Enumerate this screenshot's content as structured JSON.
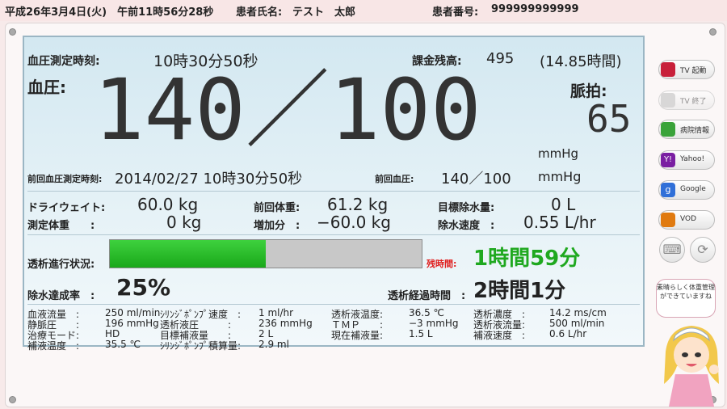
{
  "header": {
    "datetime": "平成26年3月4日(火)　午前11時56分28秒",
    "patient_name_label": "患者氏名:",
    "patient_name": "テスト　太郎",
    "patient_id_label": "患者番号:",
    "patient_id": "999999999999"
  },
  "bp": {
    "time_label": "血圧測定時刻:",
    "time": "10時30分50秒",
    "balance_label": "課金残高:",
    "balance": "495",
    "balance_hours": "(14.85時間)",
    "label": "血圧:",
    "value": "140／100",
    "unit": "mmHg",
    "pulse_label": "脈拍:",
    "pulse": "65"
  },
  "prev": {
    "time_label": "前回血圧測定時刻:",
    "datetime": "2014/02/27 10時30分50秒",
    "bp_label": "前回血圧:",
    "bp": "140／100",
    "unit": "mmHg"
  },
  "weights": {
    "dry_label": "ドライウェイト:",
    "dry": "60.0 kg",
    "prev_label": "前回体重:",
    "prev": "61.2 kg",
    "target_label": "目標除水量:",
    "target": "0 L",
    "measured_label": "測定体重　　:",
    "measured": "0 kg",
    "increase_label": "増加分　:",
    "increase": "−60.0 kg",
    "rate_label": "除水速度　:",
    "rate": "0.55 L/hr"
  },
  "progress": {
    "label": "透析進行状況:",
    "fraction": 0.5,
    "remaining_label": "残時間:",
    "remaining": "1時間59分"
  },
  "achievement": {
    "label": "除水達成率　:",
    "value": "25%",
    "elapsed_label": "透析経過時間　:",
    "elapsed": "2時間1分"
  },
  "details": [
    [
      "血液流量　:",
      "250 ml/min",
      "ｼﾘﾝｼﾞﾎﾟﾝﾌﾟ速度　:",
      "1 ml/hr",
      "透析液温度:",
      "36.5 ℃",
      "透析濃度　:",
      "14.2 ms/cm"
    ],
    [
      "静脈圧　　:",
      "196 mmHg",
      "透析液圧　　　:",
      "236 mmHg",
      "ＴＭＰ　　:",
      "−3 mmHg",
      "透析液流量:",
      "500 ml/min"
    ],
    [
      "治療モード:",
      "HD",
      "目標補液量　　:",
      "2 L",
      "現在補液量:",
      "1.5 L",
      "補液速度　:",
      "0.6 L/hr"
    ],
    [
      "補液温度　:",
      "35.5 ℃",
      "ｼﾘﾝｼﾞﾎﾟﾝﾌﾟ積算量:",
      "2.9 ml",
      "",
      "",
      "",
      ""
    ]
  ],
  "sidebar": {
    "tv_on": "TV 起動",
    "tv_off": "TV 終了",
    "hospital": "病院情報",
    "yahoo": "Yahoo!",
    "google": "Google",
    "vod": "VOD"
  },
  "mascot": {
    "bubble": "素晴らしく体重管理ができていますね"
  },
  "colors": {
    "progress_green": "#2bc02b",
    "remaining_text": "#1fa81f",
    "remaining_label": "#e02020"
  }
}
